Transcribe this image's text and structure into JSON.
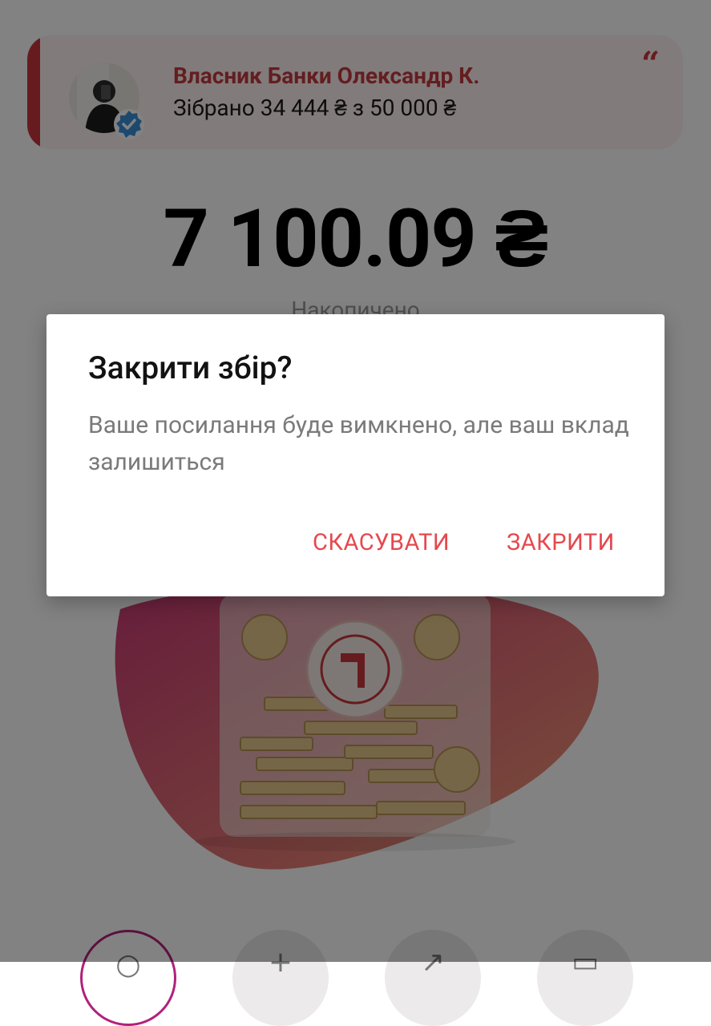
{
  "owner_card": {
    "name": "Власник Банки Олександр К.",
    "collected": "Зібрано 34 444 ₴ з 50 000 ₴"
  },
  "jar": {
    "balance": "7 100.09 ₴",
    "balance_label": "Накопичено"
  },
  "dialog": {
    "title": "Закрити збір?",
    "message": "Ваше посилання буде вимкнено, але ваш вклад залишиться",
    "cancel_label": "СКАСУВАТИ",
    "confirm_label": "ЗАКРИТИ"
  },
  "colors": {
    "accent": "#e5484d",
    "brand_red": "#c8383d",
    "scrim": "rgba(0,0,0,0.49)"
  },
  "icons": {
    "verified": "verified-badge-icon",
    "quote": "quote-icon",
    "jar_logo": "arrow-logo-icon"
  }
}
